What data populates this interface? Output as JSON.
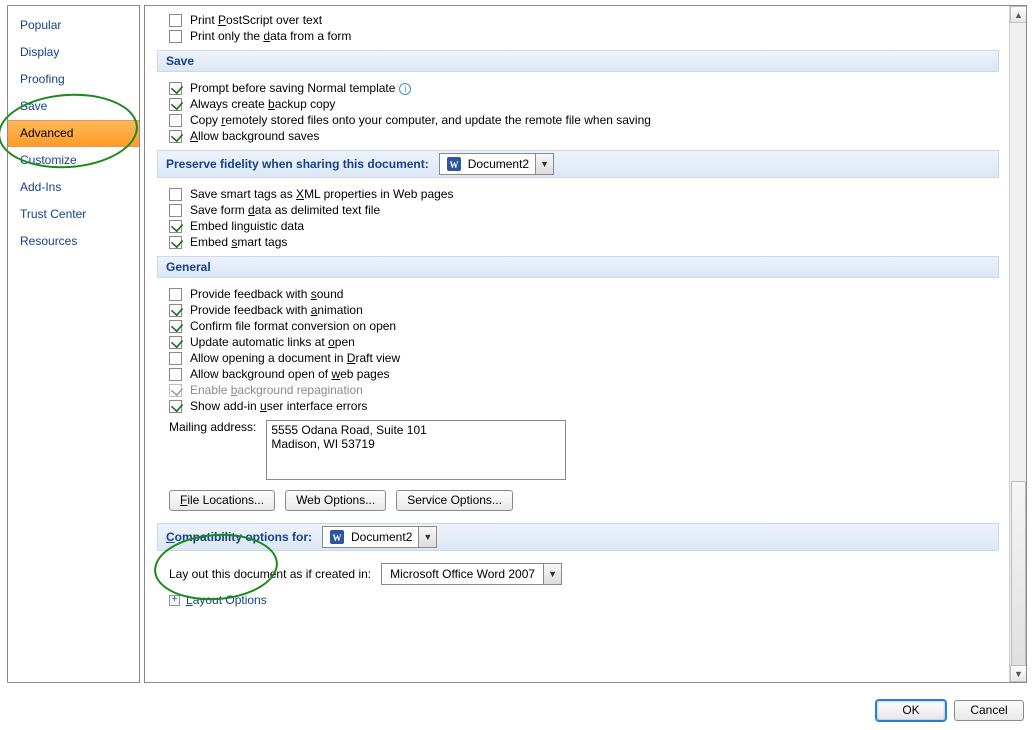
{
  "sidebar": {
    "items": [
      {
        "label": "Popular"
      },
      {
        "label": "Display"
      },
      {
        "label": "Proofing"
      },
      {
        "label": "Save"
      },
      {
        "label": "Advanced",
        "selected": true
      },
      {
        "label": "Customize"
      },
      {
        "label": "Add-Ins"
      },
      {
        "label": "Trust Center"
      },
      {
        "label": "Resources"
      }
    ]
  },
  "top_checks": [
    {
      "text_pre": "Print ",
      "u": "P",
      "text_post": "ostScript over text",
      "checked": false
    },
    {
      "text_pre": "Print only the ",
      "u": "d",
      "text_post": "ata from a form",
      "checked": false
    }
  ],
  "save": {
    "header": "Save",
    "items": [
      {
        "text": "Prompt before saving Normal template",
        "u": "",
        "checked": true,
        "info": true
      },
      {
        "text_pre": "Always create ",
        "u": "b",
        "text_post": "ackup copy",
        "checked": true
      },
      {
        "text_pre": "Copy ",
        "u": "r",
        "text_post": "emotely stored files onto your computer, and update the remote file when saving",
        "checked": false
      },
      {
        "text_pre": "",
        "u": "A",
        "text_post": "llow background saves",
        "checked": true
      }
    ]
  },
  "preserve": {
    "header": "Preserve fidelity when sharing this document:",
    "doc": "Document2",
    "items": [
      {
        "text_pre": "Save smart tags as ",
        "u": "X",
        "text_post": "ML properties in Web pages",
        "checked": false
      },
      {
        "text_pre": "Save form ",
        "u": "d",
        "text_post": "ata as delimited text file",
        "checked": false
      },
      {
        "text_pre": "Embed lin",
        "u": "g",
        "text_post": "uistic data",
        "checked": true
      },
      {
        "text_pre": "Embed ",
        "u": "s",
        "text_post": "mart tags",
        "checked": true
      }
    ]
  },
  "general": {
    "header": "General",
    "items": [
      {
        "text_pre": "Provide feedback with ",
        "u": "s",
        "text_post": "ound",
        "checked": false
      },
      {
        "text_pre": "Provide feedback with ",
        "u": "a",
        "text_post": "nimation",
        "checked": true
      },
      {
        "text": "Confirm file format conversion on open",
        "checked": true
      },
      {
        "text_pre": "Update automatic links at ",
        "u": "o",
        "text_post": "pen",
        "checked": true
      },
      {
        "text_pre": "Allow opening a document in ",
        "u": "D",
        "text_post": "raft view",
        "checked": false
      },
      {
        "text_pre": "Allow background open of ",
        "u": "w",
        "text_post": "eb pages",
        "checked": false
      },
      {
        "text_pre": "Enable ",
        "u": "b",
        "text_post": "ackground repagination",
        "checked": true,
        "disabled": true
      },
      {
        "text_pre": "Show add-in ",
        "u": "u",
        "text_post": "ser interface errors",
        "checked": true
      }
    ],
    "mailing_label": "Mailing address:",
    "mailing_value": "5555 Odana Road, Suite 101\nMadison, WI  53719",
    "buttons": {
      "file_locations": "File Locations...",
      "web_options": "Web Options...",
      "service_options": "Service Options..."
    }
  },
  "compat": {
    "header": "Compatibility options for:",
    "doc": "Document2",
    "layout_label": "Lay out this document as if created in:",
    "layout_value": "Microsoft Office Word 2007",
    "layout_options_label": "Layout Options"
  },
  "footer": {
    "ok": "OK",
    "cancel": "Cancel"
  }
}
